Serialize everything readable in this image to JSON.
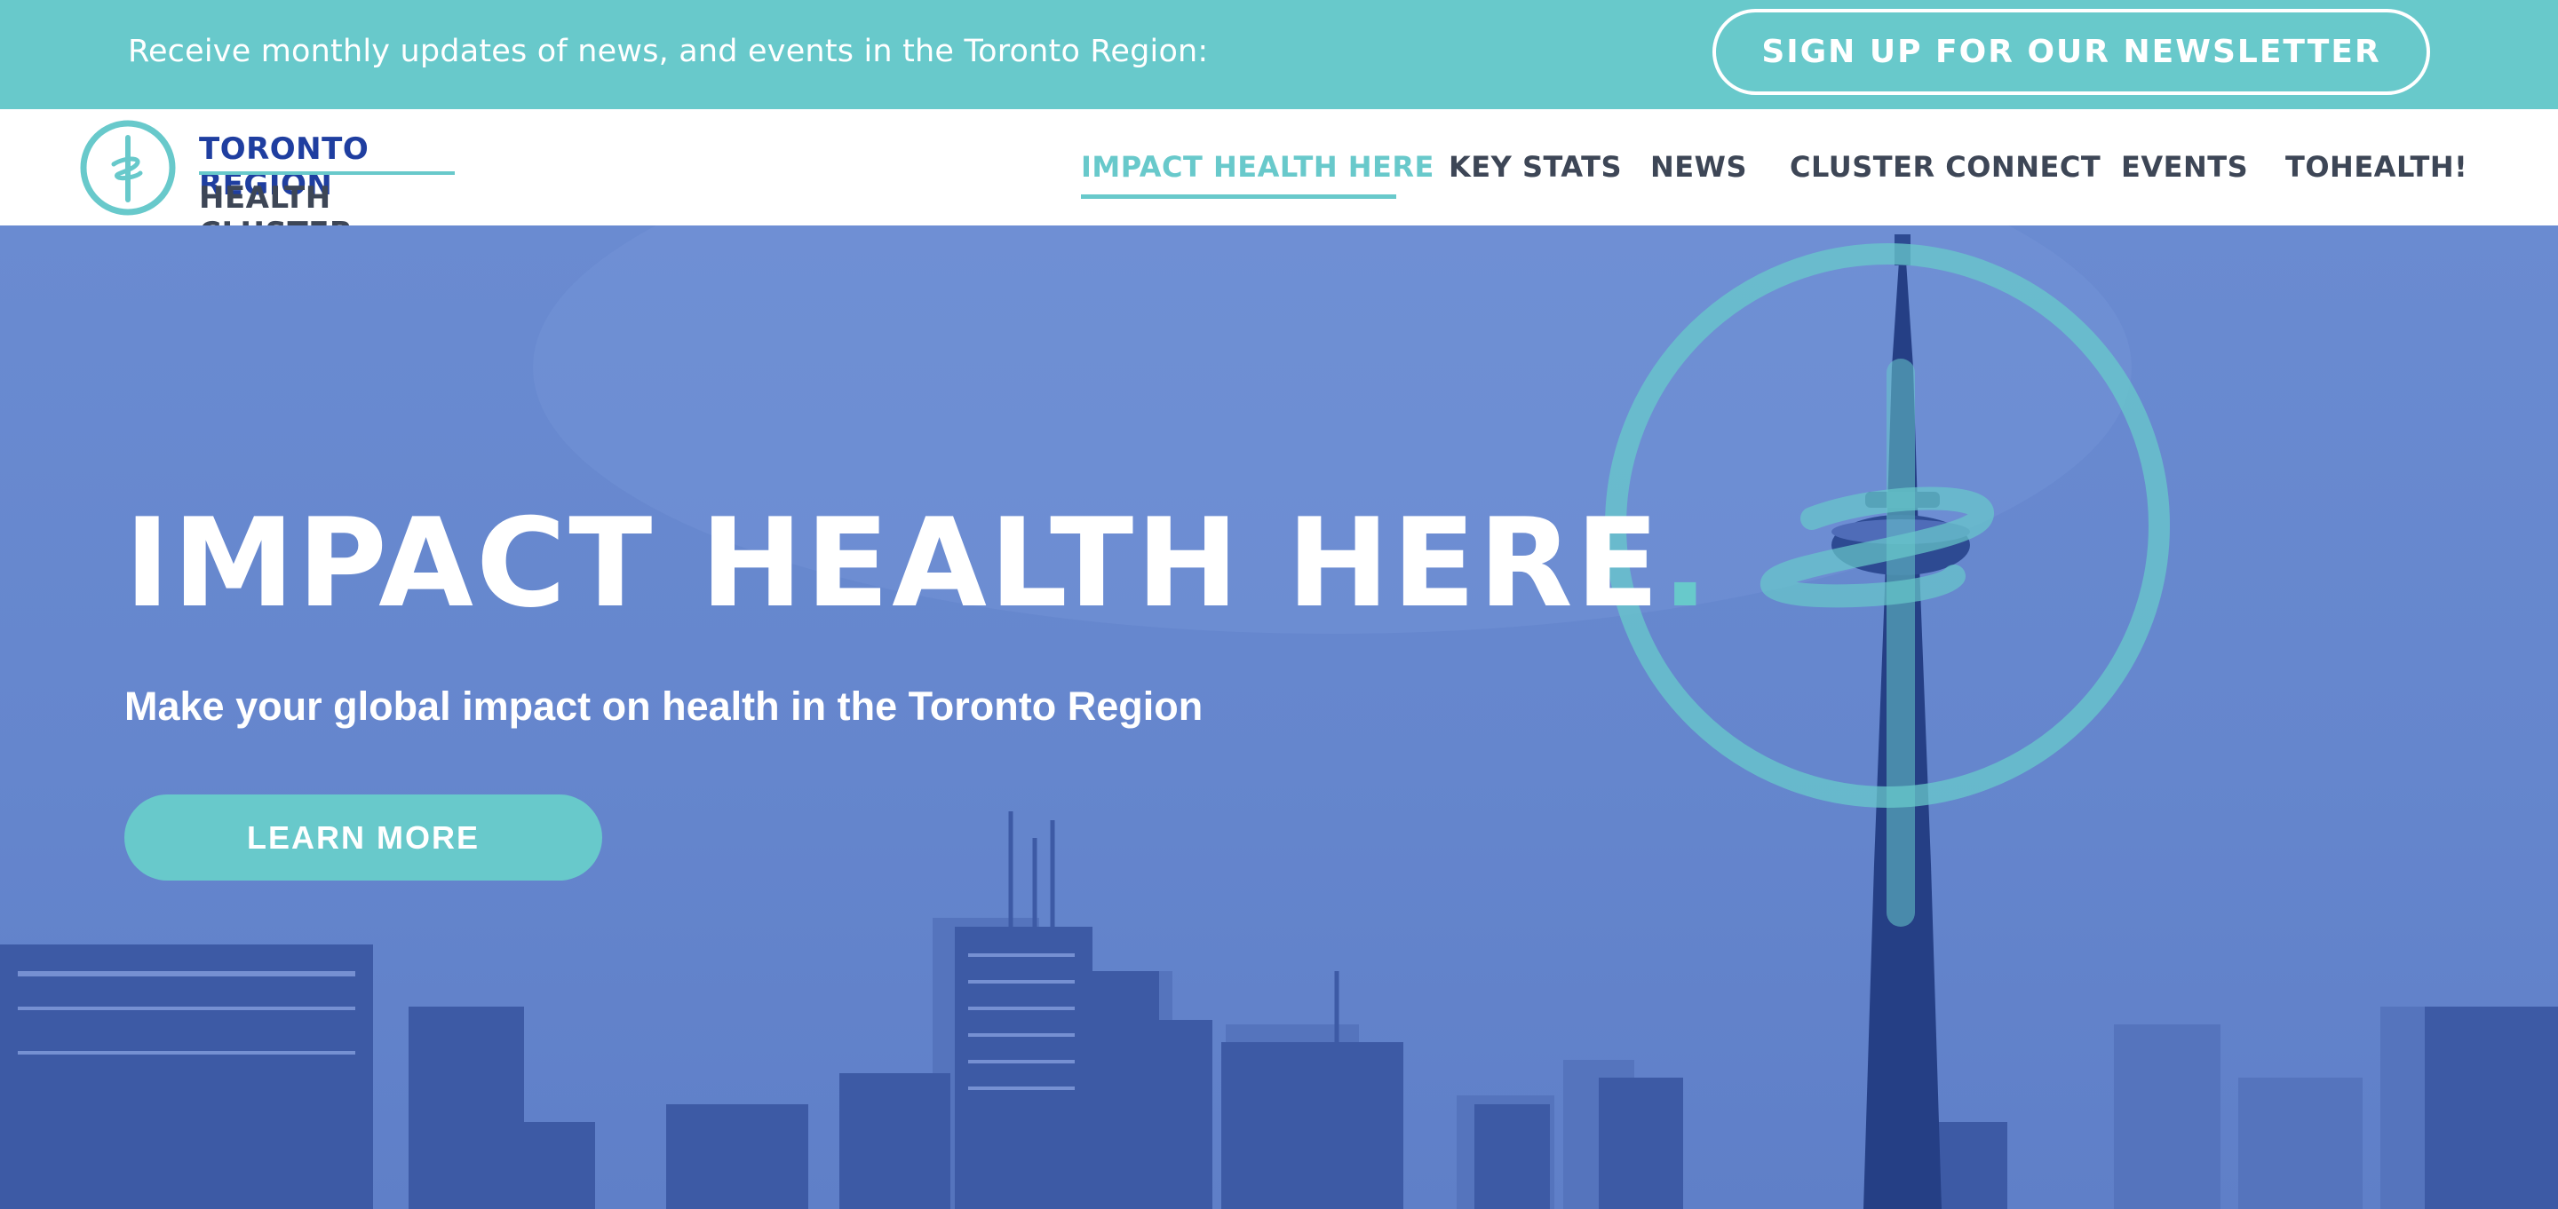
{
  "topbar": {
    "message": "Receive monthly updates of news, and events in the Toronto Region:",
    "newsletter_button": "SIGN UP FOR OUR NEWSLETTER"
  },
  "logo": {
    "line1": "TORONTO REGION",
    "line2": "HEALTH CLUSTER"
  },
  "nav": {
    "items": [
      {
        "label": "IMPACT HEALTH HERE",
        "active": true
      },
      {
        "label": "KEY STATS",
        "active": false
      },
      {
        "label": "NEWS",
        "active": false
      },
      {
        "label": "CLUSTER CONNECT",
        "active": false
      },
      {
        "label": "EVENTS",
        "active": false
      },
      {
        "label": "TOHEALTH!",
        "active": false
      }
    ]
  },
  "hero": {
    "title": "IMPACT HEALTH HERE",
    "title_dot": ".",
    "subtitle": "Make your global impact on health in the Toronto Region",
    "cta": "LEARN MORE"
  },
  "colors": {
    "accent": "#68c9cb",
    "brand_blue": "#1f3ea0",
    "nav_text": "#3d4656",
    "hero_overlay": "#6a8bd1"
  }
}
